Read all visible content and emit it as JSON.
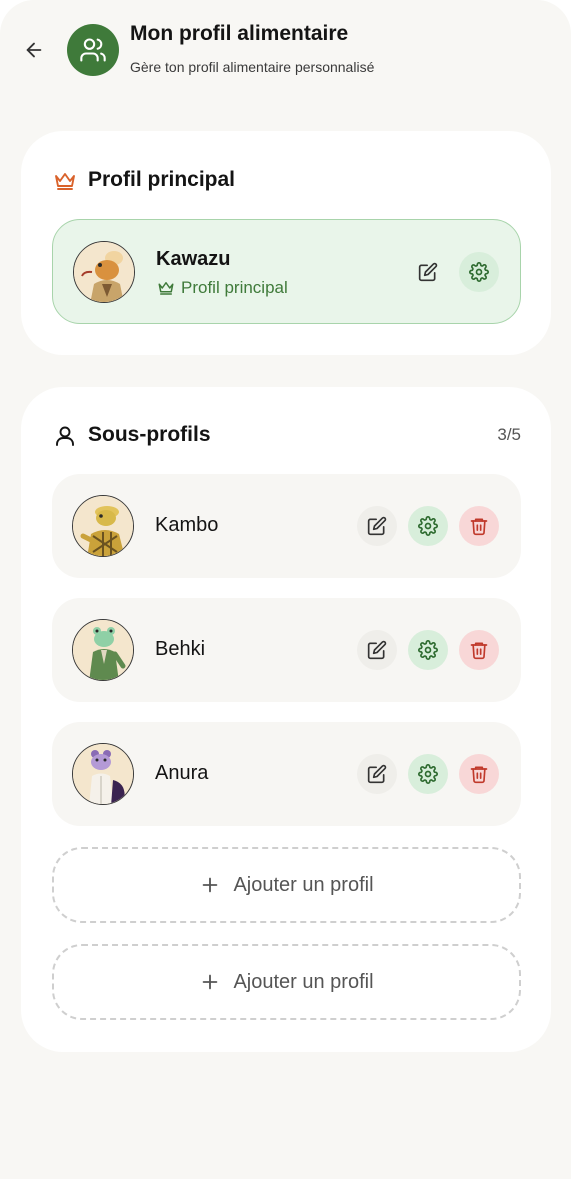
{
  "header": {
    "title": "Mon profil alimentaire",
    "subtitle": "Gère ton profil alimentaire personnalisé",
    "back_icon": "arrow-left-icon",
    "avatar_icon": "users-icon"
  },
  "main_profile": {
    "section_title": "Profil principal",
    "section_icon": "crown-icon",
    "name": "Kawazu",
    "badge": "Profil principal"
  },
  "sub_profiles": {
    "section_title": "Sous-profils",
    "section_icon": "user-icon",
    "count": "3/5",
    "items": [
      {
        "name": "Kambo"
      },
      {
        "name": "Behki"
      },
      {
        "name": "Anura"
      }
    ],
    "add_label_1": "Ajouter un profil",
    "add_label_2": "Ajouter un profil"
  },
  "colors": {
    "accent_green": "#3f7a3a",
    "crown_orange": "#d9622b",
    "trash_red": "#c0392b",
    "background": "#f8f7f4"
  }
}
